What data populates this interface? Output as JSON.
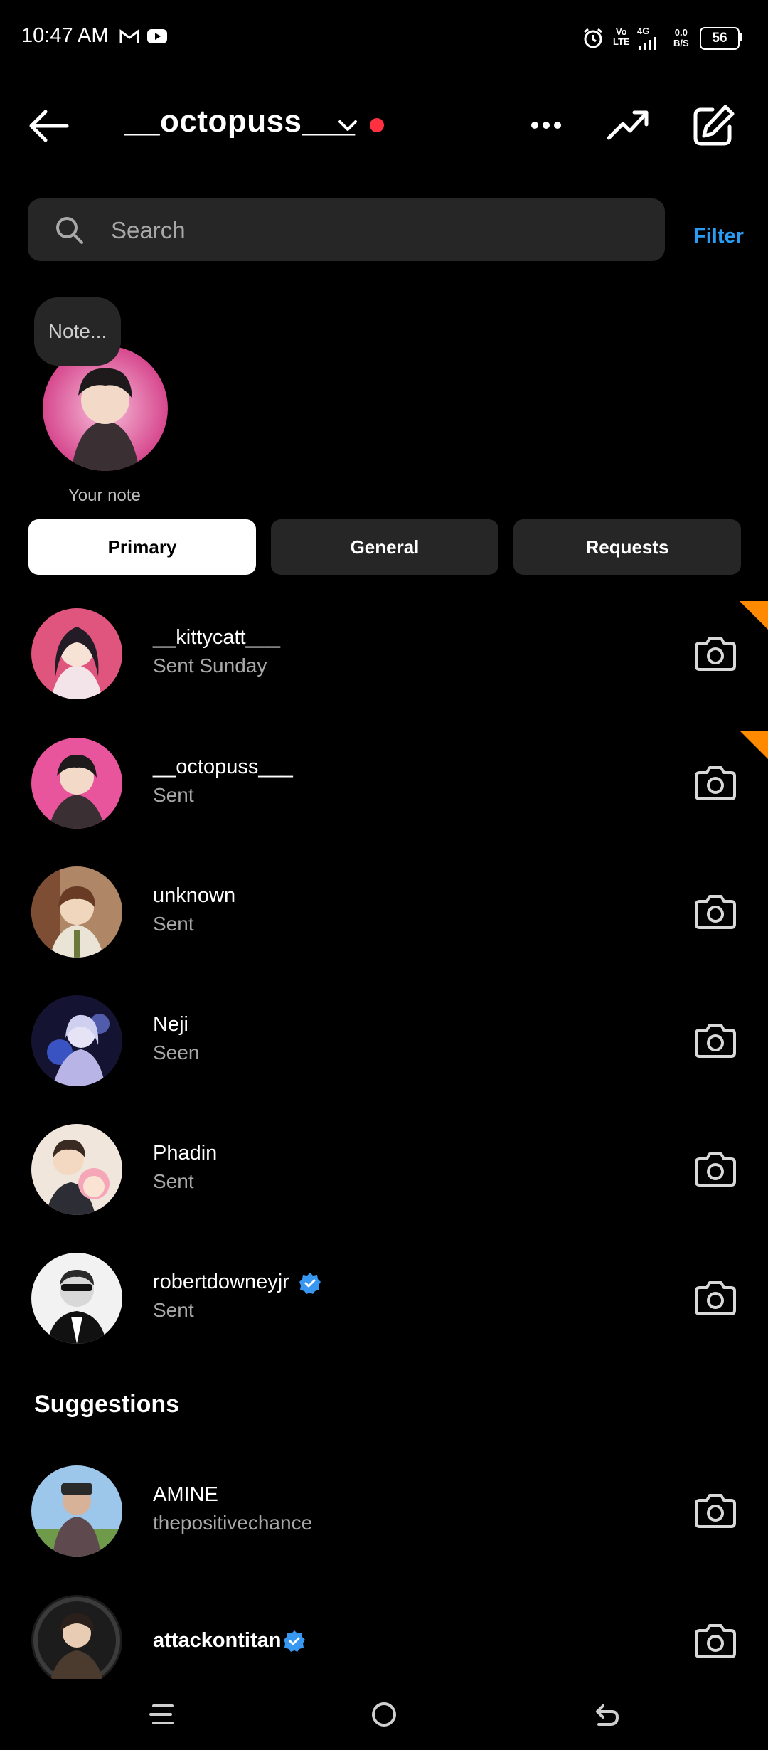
{
  "status_bar": {
    "time": "10:47 AM",
    "battery": "56",
    "network_label_1": "Vo",
    "network_label_2": "LTE",
    "network_4g": "4G",
    "speed_top": "0.0",
    "speed_bottom": "B/S"
  },
  "header": {
    "username": "__octopuss___",
    "notification_dot_color": "#ff3040"
  },
  "search": {
    "placeholder": "Search",
    "filter_label": "Filter"
  },
  "note": {
    "bubble_text": "Note...",
    "label": "Your note"
  },
  "tabs": [
    {
      "label": "Primary",
      "active": true
    },
    {
      "label": "General",
      "active": false
    },
    {
      "label": "Requests",
      "active": false
    }
  ],
  "conversations": [
    {
      "name": "__kittycatt___",
      "status": "Sent Sunday",
      "verified": false,
      "unread_corner": true
    },
    {
      "name": "__octopuss___",
      "status": "Sent",
      "verified": false,
      "unread_corner": true
    },
    {
      "name": "unknown",
      "status": "Sent",
      "verified": false,
      "unread_corner": false
    },
    {
      "name": "Neji",
      "status": "Seen",
      "verified": false,
      "unread_corner": false
    },
    {
      "name": "Phadin",
      "status": "Sent",
      "verified": false,
      "unread_corner": false
    },
    {
      "name": "robertdowneyjr",
      "status": "Sent",
      "verified": true,
      "unread_corner": false
    }
  ],
  "suggestions": {
    "title": "Suggestions",
    "items": [
      {
        "name": "AMINE",
        "subtitle": "thepositivechance",
        "verified": false
      },
      {
        "name": "attackontitan",
        "subtitle": "",
        "verified": true
      }
    ]
  },
  "colors": {
    "accent_blue": "#2a9cf4",
    "verified_blue": "#3897f0",
    "unread_orange": "#ff8a00",
    "background": "#000000",
    "surface": "#262626"
  }
}
